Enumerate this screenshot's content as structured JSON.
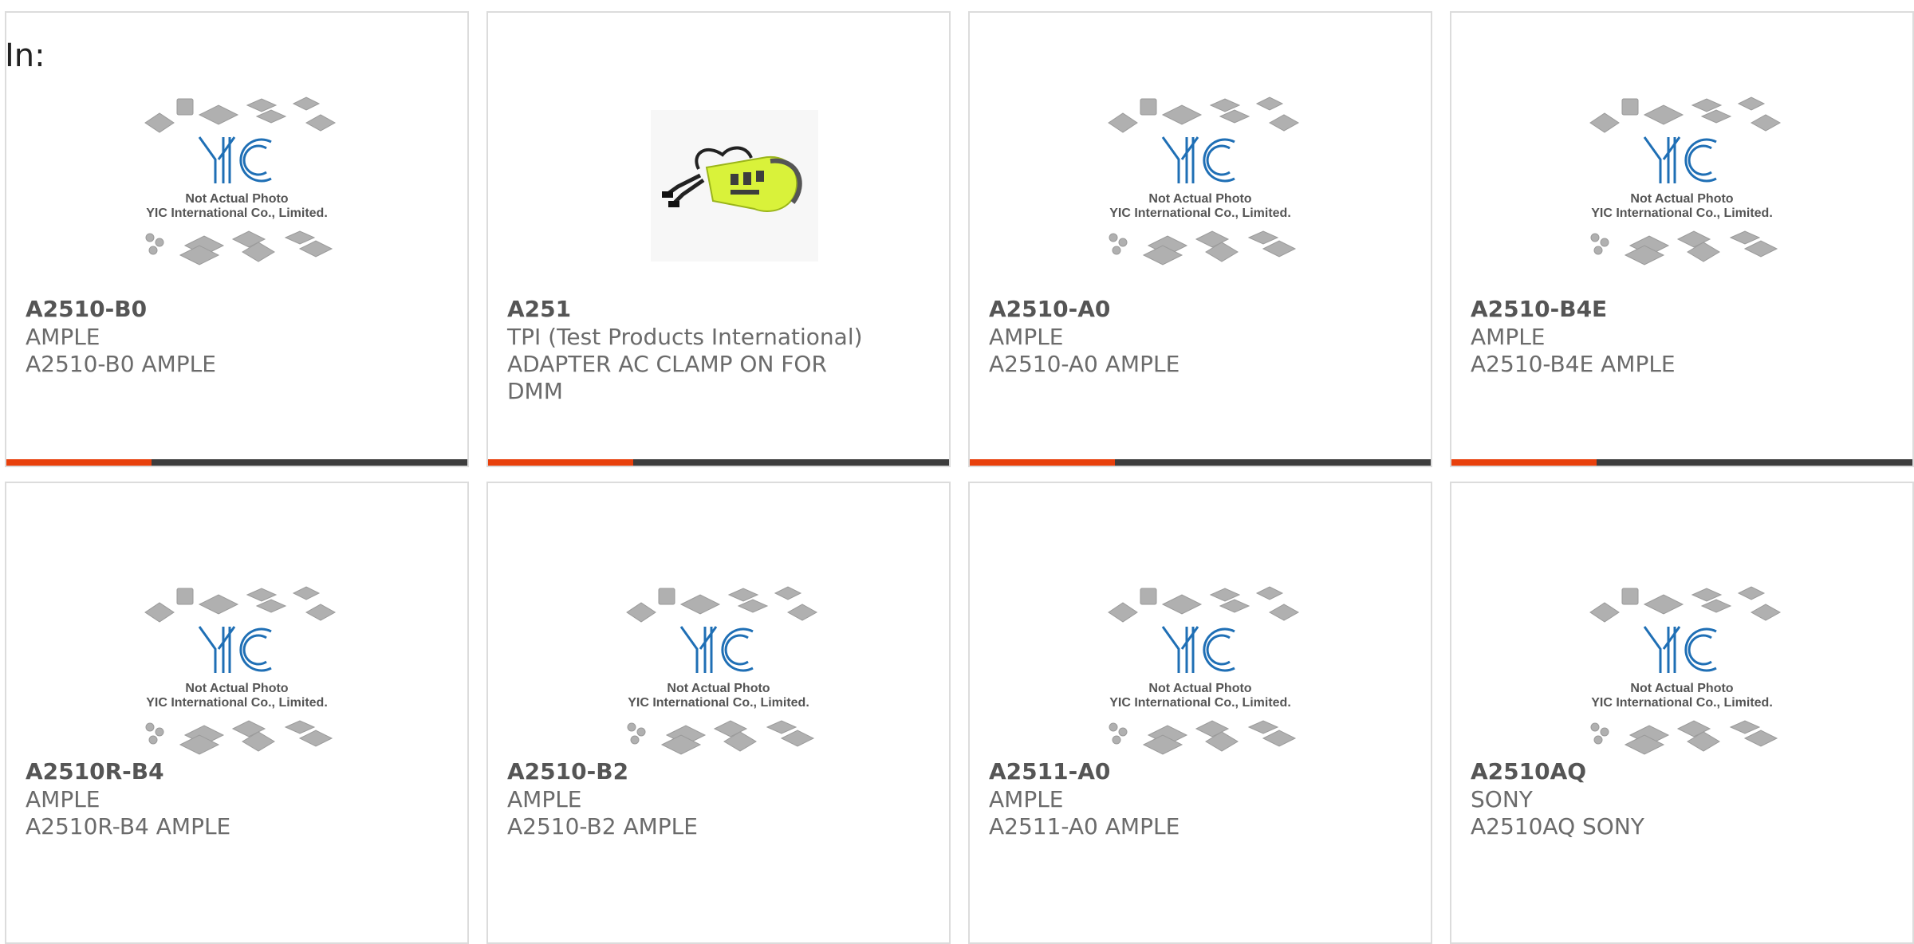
{
  "in_label": "In:",
  "placeholder": {
    "line1": "Not Actual Photo",
    "line2": "YIC International Co., Limited."
  },
  "products": [
    {
      "part": "A2510-B0",
      "manufacturer": "AMPLE",
      "description": "A2510-B0 AMPLE",
      "image": "placeholder"
    },
    {
      "part": "A251",
      "manufacturer": "TPI (Test Products International)",
      "description": "ADAPTER AC CLAMP ON FOR DMM",
      "image": "clamp-adapter-photo"
    },
    {
      "part": "A2510-A0",
      "manufacturer": "AMPLE",
      "description": "A2510-A0 AMPLE",
      "image": "placeholder"
    },
    {
      "part": "A2510-B4E",
      "manufacturer": "AMPLE",
      "description": "A2510-B4E AMPLE",
      "image": "placeholder"
    },
    {
      "part": "A2510R-B4",
      "manufacturer": "AMPLE",
      "description": "A2510R-B4 AMPLE",
      "image": "placeholder"
    },
    {
      "part": "A2510-B2",
      "manufacturer": "AMPLE",
      "description": "A2510-B2 AMPLE",
      "image": "placeholder"
    },
    {
      "part": "A2511-A0",
      "manufacturer": "AMPLE",
      "description": "A2511-A0 AMPLE",
      "image": "placeholder"
    },
    {
      "part": "A2510AQ",
      "manufacturer": "SONY",
      "description": "A2510AQ SONY",
      "image": "placeholder"
    }
  ],
  "colors": {
    "accent": "#e8400c",
    "bar_dark": "#3d3d3d",
    "border": "#dcdcdc",
    "logo_blue": "#1f6fb5"
  }
}
